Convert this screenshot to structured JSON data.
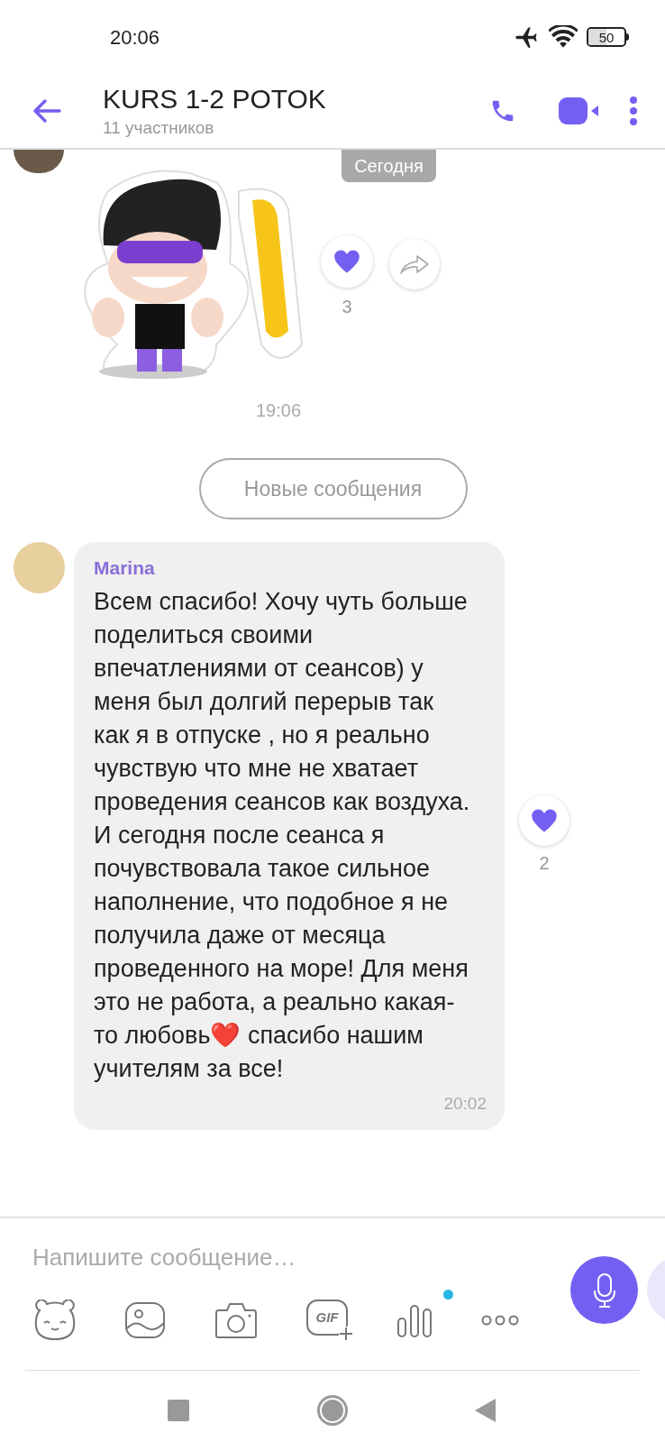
{
  "status_bar": {
    "time": "20:06",
    "battery": "50"
  },
  "header": {
    "title": "KURS 1-2 POTOK",
    "subtitle": "11 участников"
  },
  "date_badge": "Сегодня",
  "sticker_message": {
    "reaction_count": "3",
    "liked": true,
    "time": "19:06"
  },
  "new_messages_label": "Новые сообщения",
  "message": {
    "sender": "Marina",
    "text": "Всем спасибо! Хочу чуть больше поделиться своими впечатлениями от сеансов) у меня был долгий перерыв так как я в отпуске , но я реально чувствую что мне не хватает проведения сеансов как воздуха. И сегодня после сеанса я почувствовала такое сильное наполнение, что подобное я не получила даже от месяца проведенного на море! Для меня это не работа, а реально какая-то любовь❤️ спасибо нашим учителям за все!",
    "time": "20:02",
    "reaction_count": "2",
    "liked": true
  },
  "composer": {
    "placeholder": "Напишите сообщение…",
    "gif_label": "GIF",
    "poll_badge": true
  }
}
